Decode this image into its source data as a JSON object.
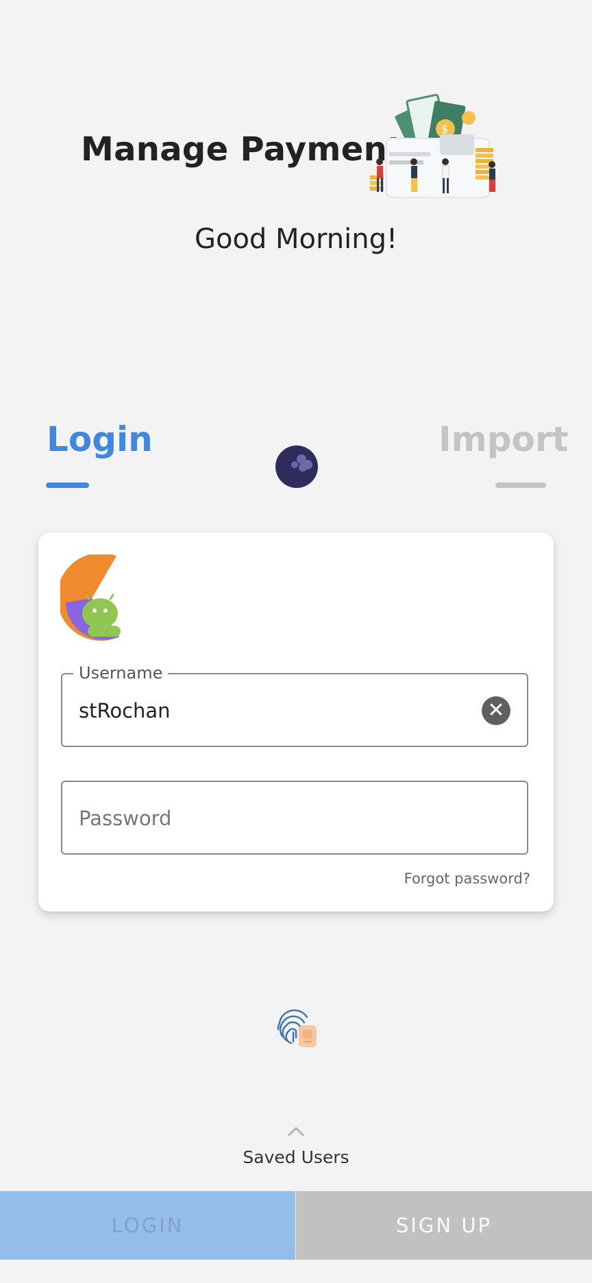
{
  "header": {
    "title": "Manage Payments",
    "greeting": "Good Morning!",
    "illustration_icon": "payments-illustration"
  },
  "tabs": [
    {
      "label": "Login",
      "active": true,
      "color": "#3f87df"
    },
    {
      "label": "Import",
      "active": false,
      "color": "#c4c4c4"
    }
  ],
  "theme_toggle_icon": "moon-icon",
  "card": {
    "logo_icon": "app-logo-android",
    "username": {
      "label": "Username",
      "value": "stRochan",
      "clear_icon": "clear-icon"
    },
    "password": {
      "placeholder": "Password"
    },
    "forgot_password": "Forgot password?"
  },
  "fingerprint_icon": "fingerprint-icon",
  "saved_users": {
    "label": "Saved Users",
    "icon": "chevron-up-icon"
  },
  "buttons": {
    "login": "LOGIN",
    "signup": "SIGN UP"
  },
  "colors": {
    "accent": "#3f87df",
    "background": "#f3f3f4",
    "login_button_bg": "#96bde9",
    "signup_button_bg": "#c1c1c1"
  }
}
